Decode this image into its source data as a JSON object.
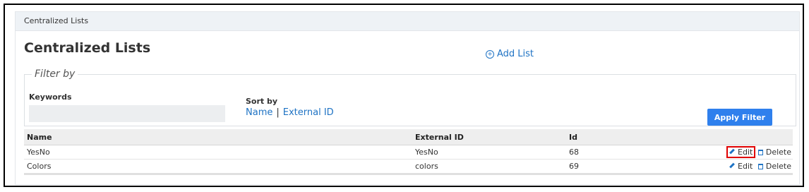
{
  "breadcrumb": "Centralized Lists",
  "page_title": "Centralized Lists",
  "add_list_label": "Add List",
  "filter": {
    "legend": "Filter by",
    "keywords_label": "Keywords",
    "keywords_value": "",
    "sort_label": "Sort by",
    "sort_name": "Name",
    "sort_separator": "|",
    "sort_external_id": "External ID",
    "apply_label": "Apply Filter"
  },
  "table": {
    "headers": {
      "name": "Name",
      "external_id": "External ID",
      "id": "Id"
    },
    "rows": [
      {
        "name": "YesNo",
        "external_id": "YesNo",
        "id": "68",
        "edit": "Edit",
        "delete": "Delete"
      },
      {
        "name": "Colors",
        "external_id": "colors",
        "id": "69",
        "edit": "Edit",
        "delete": "Delete"
      }
    ]
  },
  "colors": {
    "accent": "#1f73c4",
    "button": "#2f80ed",
    "highlight": "#e00000"
  },
  "icons": {
    "add": "plus-circle-icon",
    "edit": "pencil-icon",
    "delete": "trash-icon"
  }
}
